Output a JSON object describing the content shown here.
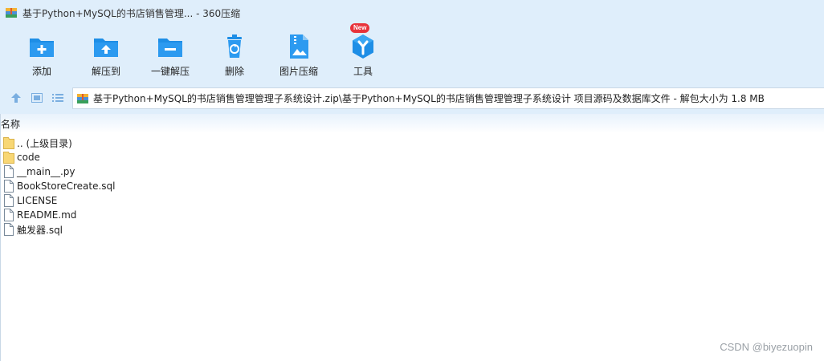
{
  "window": {
    "title": "基于Python+MySQL的书店销售管理... - 360压缩"
  },
  "toolbar": {
    "items": [
      {
        "label": "添加",
        "icon": "add-archive-icon"
      },
      {
        "label": "解压到",
        "icon": "extract-to-icon"
      },
      {
        "label": "一键解压",
        "icon": "quick-extract-icon"
      },
      {
        "label": "删除",
        "icon": "delete-icon"
      },
      {
        "label": "图片压缩",
        "icon": "image-compress-icon"
      },
      {
        "label": "工具",
        "icon": "tools-icon",
        "badge": "New"
      }
    ]
  },
  "addressbar": {
    "path": "基于Python+MySQL的书店销售管理管理子系统设计.zip\\基于Python+MySQL的书店销售管理管理子系统设计 项目源码及数据库文件 - 解包大小为 1.8 MB"
  },
  "list": {
    "column_name": "名称",
    "rows": [
      {
        "name": ".. (上级目录)",
        "type": "folder"
      },
      {
        "name": "code",
        "type": "folder"
      },
      {
        "name": "__main__.py",
        "type": "file"
      },
      {
        "name": "BookStoreCreate.sql",
        "type": "file"
      },
      {
        "name": "LICENSE",
        "type": "file"
      },
      {
        "name": "README.md",
        "type": "file"
      },
      {
        "name": "触发器.sql",
        "type": "file"
      }
    ]
  },
  "watermark": "CSDN @biyezuopin",
  "colors": {
    "chrome_bg": "#dfeefb",
    "accent_blue": "#1e8ee6",
    "badge_red": "#e8333a"
  }
}
